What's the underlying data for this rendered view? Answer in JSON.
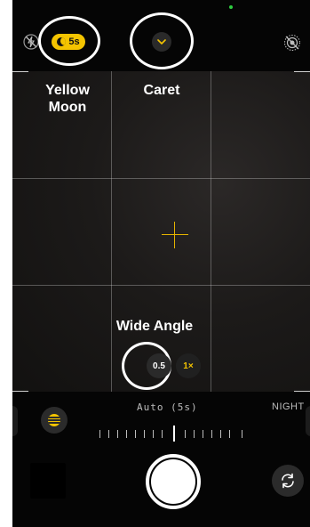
{
  "top_bar": {
    "night_mode_pill": "5s",
    "flash_icon": "flash-off-icon",
    "live_icon": "live-photo-off-icon",
    "caret_icon": "chevron-down-icon"
  },
  "annotations": {
    "yellow_moon": "Yellow Moon",
    "caret": "Caret",
    "wide_angle": "Wide Angle"
  },
  "zoom": {
    "ultra_wide": "0.5",
    "wide": "1×"
  },
  "exposure": {
    "auto_label": "Auto (5s)",
    "mode_label": "NIGHT"
  },
  "colors": {
    "accent_yellow": "#f4c400",
    "background": "#0a0a0a"
  }
}
